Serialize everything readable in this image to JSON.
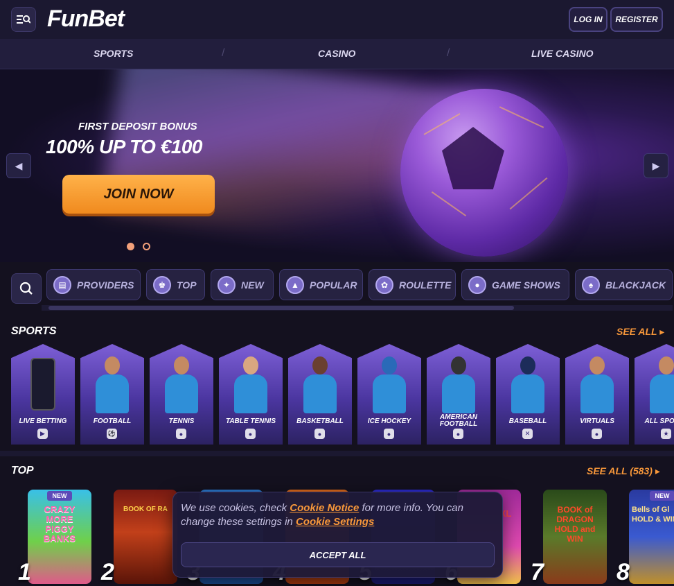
{
  "header": {
    "logo": "FunBet",
    "login_label": "LOG IN",
    "register_label": "REGISTER"
  },
  "nav": {
    "items": [
      {
        "label": "SPORTS"
      },
      {
        "label": "CASINO"
      },
      {
        "label": "LIVE CASINO"
      }
    ],
    "separator": "/"
  },
  "hero": {
    "subtitle": "FIRST DEPOSIT BONUS",
    "title": "100% UP TO €100",
    "cta_label": "JOIN NOW",
    "slide_count": 2,
    "active_slide": 1,
    "colors": {
      "cta": "#f5962e",
      "active_dot": "#f2a07a"
    }
  },
  "categories": [
    {
      "label": "PROVIDERS",
      "icon": "book-icon"
    },
    {
      "label": "TOP",
      "icon": "crown-icon"
    },
    {
      "label": "NEW",
      "icon": "lightning-icon"
    },
    {
      "label": "POPULAR",
      "icon": "flame-icon"
    },
    {
      "label": "ROULETTE",
      "icon": "roulette-icon"
    },
    {
      "label": "GAME SHOWS",
      "icon": "gameshow-icon"
    },
    {
      "label": "BLACKJACK",
      "icon": "spade-icon"
    }
  ],
  "sports": {
    "title": "SPORTS",
    "see_all": "SEE ALL",
    "items": [
      {
        "label": "LIVE BETTING",
        "icon": "play-icon"
      },
      {
        "label": "FOOTBALL",
        "icon": "soccer-ball-icon"
      },
      {
        "label": "TENNIS",
        "icon": "tennis-ball-icon"
      },
      {
        "label": "TABLE TENNIS",
        "icon": "ping-pong-icon"
      },
      {
        "label": "BASKETBALL",
        "icon": "basketball-icon"
      },
      {
        "label": "ICE HOCKEY",
        "icon": "hockey-icon"
      },
      {
        "label": "AMERICAN FOOTBALL",
        "icon": "american-football-icon"
      },
      {
        "label": "BASEBALL",
        "icon": "baseball-icon"
      },
      {
        "label": "VIRTUALS",
        "icon": "gamepad-icon"
      },
      {
        "label": "ALL SPORTS",
        "icon": "trophy-icon"
      }
    ]
  },
  "top": {
    "title": "TOP",
    "see_all": "SEE ALL (583)",
    "games": [
      {
        "rank": "1",
        "badge": "NEW",
        "title": "CRAZY MORE PIGGY BANKS"
      },
      {
        "rank": "2",
        "badge": "",
        "title": "BOOK OF RA"
      },
      {
        "rank": "3",
        "badge": "",
        "title": ""
      },
      {
        "rank": "4",
        "badge": "",
        "title": ""
      },
      {
        "rank": "5",
        "badge": "",
        "title": ""
      },
      {
        "rank": "6",
        "badge": "",
        "title": "XL"
      },
      {
        "rank": "7",
        "badge": "",
        "title": "BOOK of DRAGON HOLD and WIN"
      },
      {
        "rank": "8",
        "badge": "NEW",
        "title": "Bells of Gl HOLD & WIN"
      }
    ]
  },
  "cookie": {
    "text_1": "We use cookies, check ",
    "link_1": "Cookie Notice",
    "text_2": " for more info. You can change these settings in ",
    "link_2": "Cookie Settings",
    "accept_label": "ACCEPT ALL"
  }
}
